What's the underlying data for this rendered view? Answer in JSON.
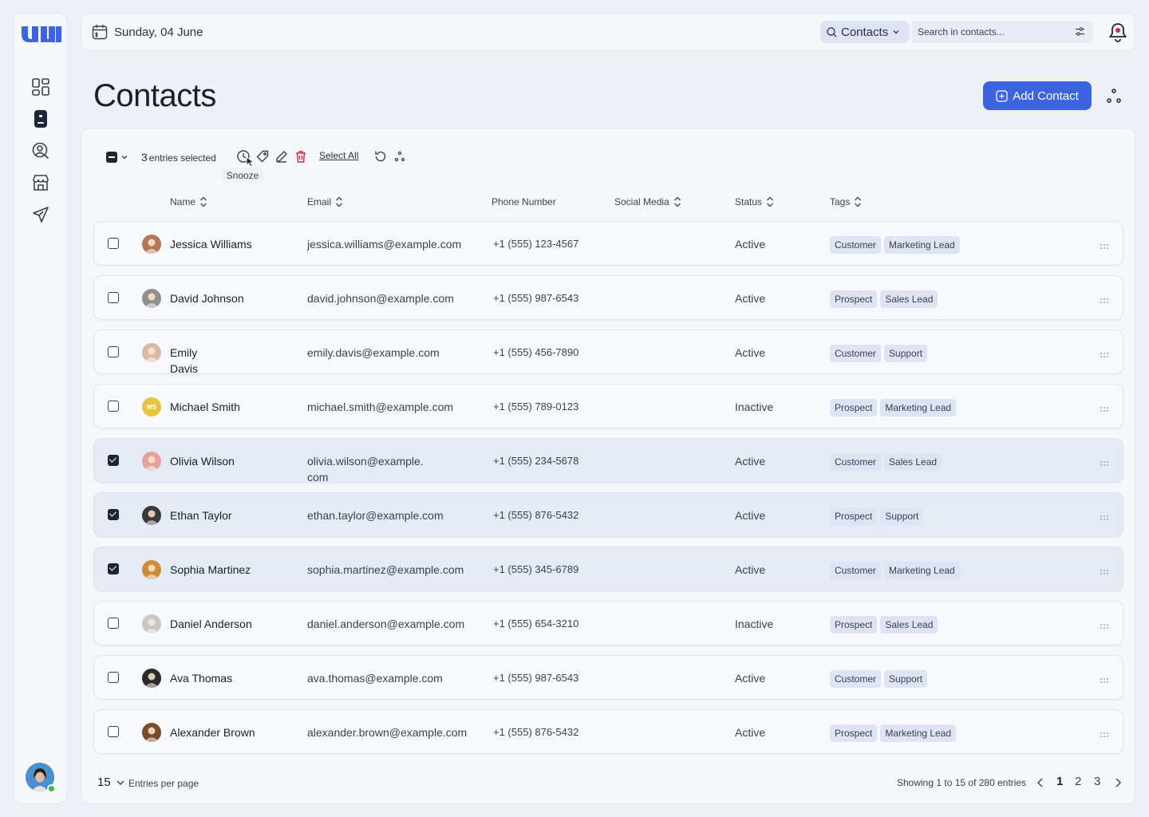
{
  "header": {
    "date": "Sunday, 04 June",
    "scope": "Contacts",
    "search_placeholder": "Search in contacts..."
  },
  "page": {
    "title": "Contacts",
    "add_button": "Add Contact"
  },
  "toolbar": {
    "count": "3",
    "entries_selected": "entries selected",
    "select_all": "Select All",
    "tooltip": "Snooze"
  },
  "columns": [
    "Name",
    "Email",
    "Phone Number",
    "Social Media",
    "Status",
    "Tags"
  ],
  "contacts": [
    {
      "name": "Jessica Williams",
      "email": "jessica.williams@example.com",
      "phone": "+1 (555) 123-4567",
      "status": "Active",
      "tags": [
        "Customer",
        "Marketing Lead"
      ],
      "selected": false,
      "avatar": "photo"
    },
    {
      "name": "David Johnson",
      "email": "david.johnson@example.com",
      "phone": "+1 (555) 987-6543",
      "status": "Active",
      "tags": [
        "Prospect",
        "Sales Lead"
      ],
      "selected": false,
      "avatar": "photo"
    },
    {
      "name": "Emily\nDavis",
      "email": "emily.davis@example.com",
      "phone": "+1 (555) 456-7890",
      "status": "Active",
      "tags": [
        "Customer",
        "Support"
      ],
      "selected": false,
      "avatar": "photo"
    },
    {
      "name": "Michael Smith",
      "email": "michael.smith@example.com",
      "phone": "+1 (555) 789-0123",
      "status": "Inactive",
      "tags": [
        "Prospect",
        "Marketing Lead"
      ],
      "selected": false,
      "avatar": "MS"
    },
    {
      "name": "Olivia Wilson",
      "email": "olivia.wilson@example.\ncom",
      "phone": "+1 (555) 234-5678",
      "status": "Active",
      "tags": [
        "Customer",
        "Sales Lead"
      ],
      "selected": true,
      "avatar": "photo"
    },
    {
      "name": "Ethan Taylor",
      "email": "ethan.taylor@example.com",
      "phone": "+1 (555) 876-5432",
      "status": "Active",
      "tags": [
        "Prospect",
        "Support"
      ],
      "selected": true,
      "avatar": "photo"
    },
    {
      "name": "Sophia Martinez",
      "email": "sophia.martinez@example.com",
      "phone": "+1 (555) 345-6789",
      "status": "Active",
      "tags": [
        "Customer",
        "Marketing Lead"
      ],
      "selected": true,
      "avatar": "photo"
    },
    {
      "name": "Daniel Anderson",
      "email": "daniel.anderson@example.com",
      "phone": "+1 (555) 654-3210",
      "status": "Inactive",
      "tags": [
        "Prospect",
        "Sales Lead"
      ],
      "selected": false,
      "avatar": "photo"
    },
    {
      "name": "Ava Thomas",
      "email": "ava.thomas@example.com",
      "phone": "+1 (555) 987-6543",
      "status": "Active",
      "tags": [
        "Customer",
        "Support"
      ],
      "selected": false,
      "avatar": "photo"
    },
    {
      "name": "Alexander Brown",
      "email": "alexander.brown@example.com",
      "phone": "+1 (555) 876-5432",
      "status": "Active",
      "tags": [
        "Prospect",
        "Marketing Lead"
      ],
      "selected": false,
      "avatar": "photo"
    }
  ],
  "footer": {
    "per_page": "15",
    "per_page_label": "Entries per page",
    "showing": "Showing 1 to 15 of 280 entries",
    "pages": [
      "1",
      "2",
      "3"
    ]
  },
  "colors": {
    "accent": "#3c63e0",
    "tag_bg": "#dfe4f4",
    "selected_row": "#e6eaf5",
    "online": "#3dbb4f"
  }
}
